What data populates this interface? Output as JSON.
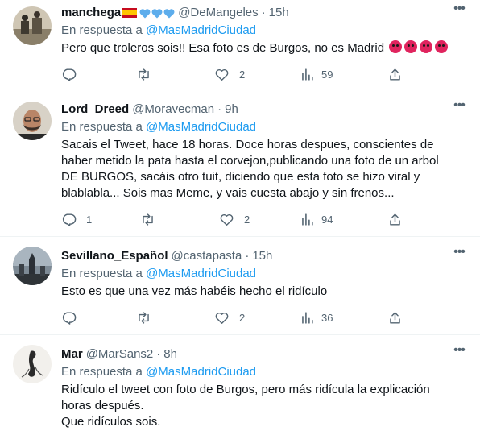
{
  "reply_prefix": "En respuesta a",
  "colors": {
    "link": "#1d9bf0",
    "muted": "#536471",
    "text": "#0f1419"
  },
  "tweets": [
    {
      "name": "manchega",
      "handle": "@DeMangeles",
      "time": "15h",
      "reply_to": "@MasMadridCiudad",
      "text": [
        "Pero que troleros sois!! Esa foto es de Burgos, no es Madrid"
      ],
      "name_decorations": [
        "spain-flag",
        "blue-heart",
        "blue-heart",
        "blue-heart"
      ],
      "text_emoji": [
        "angry-face",
        "angry-face",
        "angry-face",
        "angry-face"
      ],
      "replies": "",
      "likes": "2",
      "views": "59"
    },
    {
      "name": "Lord_Dreed",
      "handle": "@Moravecman",
      "time": "9h",
      "reply_to": "@MasMadridCiudad",
      "text": [
        "Sacais el Tweet, hace 18 horas. Doce horas despues, conscientes de",
        "haber metido la pata hasta el corvejon,publicando una foto de un arbol",
        "DE BURGOS, sacáis otro tuit, diciendo que esta foto se hizo viral y",
        "blablabla... Sois mas Meme, y vais cuesta abajo y sin frenos..."
      ],
      "replies": "1",
      "likes": "2",
      "views": "94"
    },
    {
      "name": "Sevillano_Español",
      "handle": "@castapasta",
      "time": "15h",
      "reply_to": "@MasMadridCiudad",
      "text": [
        "Esto es que una vez más habéis hecho el ridículo"
      ],
      "replies": "",
      "likes": "2",
      "views": "36"
    },
    {
      "name": "Mar",
      "handle": "@MarSans2",
      "time": "8h",
      "reply_to": "@MasMadridCiudad",
      "text": [
        "Ridículo el tweet con foto de Burgos, pero más ridícula la explicación",
        "horas después.",
        "Que ridículos sois."
      ]
    }
  ]
}
